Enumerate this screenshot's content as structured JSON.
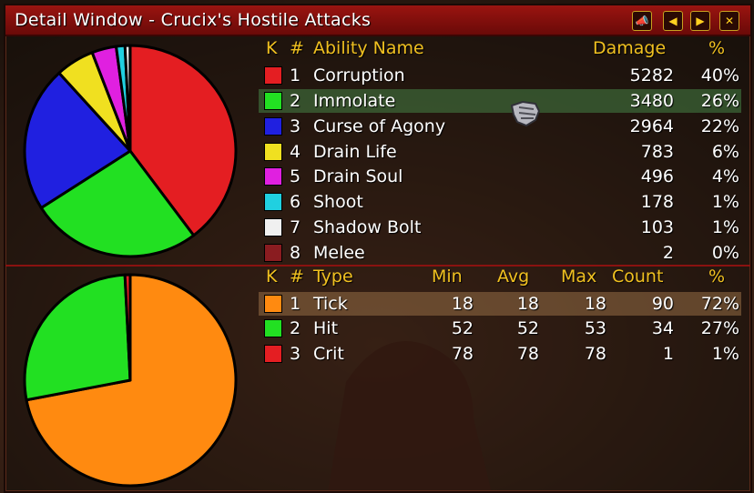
{
  "window": {
    "title": "Detail Window - Crucix's Hostile Attacks",
    "buttons": [
      {
        "icon": "report-horn-icon",
        "glyph": "📣"
      },
      {
        "icon": "prev-arrow-icon",
        "glyph": "◀"
      },
      {
        "icon": "next-arrow-icon",
        "glyph": "▶"
      },
      {
        "icon": "close-icon",
        "glyph": "✕"
      }
    ]
  },
  "abilities": {
    "headers": {
      "k": "K",
      "num": "#",
      "name": "Ability Name",
      "damage": "Damage",
      "pct": "%"
    },
    "rows": [
      {
        "num": "1",
        "name": "Corruption",
        "damage": "5282",
        "pct": "40%",
        "color": "#e41e22"
      },
      {
        "num": "2",
        "name": "Immolate",
        "damage": "3480",
        "pct": "26%",
        "color": "#22e022"
      },
      {
        "num": "3",
        "name": "Curse of Agony",
        "damage": "2964",
        "pct": "22%",
        "color": "#2020e0"
      },
      {
        "num": "4",
        "name": "Drain Life",
        "damage": "783",
        "pct": "6%",
        "color": "#f0e020"
      },
      {
        "num": "5",
        "name": "Drain Soul",
        "damage": "496",
        "pct": "4%",
        "color": "#e020e0"
      },
      {
        "num": "6",
        "name": "Shoot",
        "damage": "178",
        "pct": "1%",
        "color": "#20d0e0"
      },
      {
        "num": "7",
        "name": "Shadow Bolt",
        "damage": "103",
        "pct": "1%",
        "color": "#f0f0f0"
      },
      {
        "num": "8",
        "name": "Melee",
        "damage": "2",
        "pct": "0%",
        "color": "#8a1c20"
      }
    ]
  },
  "types": {
    "headers": {
      "k": "K",
      "num": "#",
      "type": "Type",
      "min": "Min",
      "avg": "Avg",
      "max": "Max",
      "count": "Count",
      "pct": "%"
    },
    "rows": [
      {
        "num": "1",
        "type": "Tick",
        "min": "18",
        "avg": "18",
        "max": "18",
        "count": "90",
        "pct": "72%",
        "color": "#ff8a10"
      },
      {
        "num": "2",
        "type": "Hit",
        "min": "52",
        "avg": "52",
        "max": "53",
        "count": "34",
        "pct": "27%",
        "color": "#22e022"
      },
      {
        "num": "3",
        "type": "Crit",
        "min": "78",
        "avg": "78",
        "max": "78",
        "count": "1",
        "pct": "1%",
        "color": "#e41e22"
      }
    ]
  },
  "chart_data": [
    {
      "type": "pie",
      "categories": [
        "Corruption",
        "Immolate",
        "Curse of Agony",
        "Drain Life",
        "Drain Soul",
        "Shoot",
        "Shadow Bolt",
        "Melee"
      ],
      "values": [
        5282,
        3480,
        2964,
        783,
        496,
        178,
        103,
        2
      ],
      "colors": [
        "#e41e22",
        "#22e022",
        "#2020e0",
        "#f0e020",
        "#e020e0",
        "#20d0e0",
        "#f0f0f0",
        "#8a1c20"
      ]
    },
    {
      "type": "pie",
      "categories": [
        "Tick",
        "Hit",
        "Crit"
      ],
      "values": [
        90,
        34,
        1
      ],
      "colors": [
        "#ff8a10",
        "#22e022",
        "#e41e22"
      ]
    }
  ]
}
